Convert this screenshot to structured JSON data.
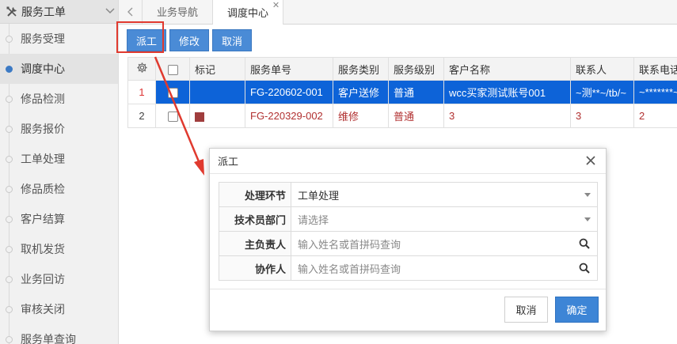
{
  "sidebar": {
    "title": "服务工单",
    "items": [
      {
        "label": "服务受理"
      },
      {
        "label": "调度中心",
        "active": true
      },
      {
        "label": "修品检测"
      },
      {
        "label": "服务报价"
      },
      {
        "label": "工单处理"
      },
      {
        "label": "修品质检"
      },
      {
        "label": "客户结算"
      },
      {
        "label": "取机发货"
      },
      {
        "label": "业务回访"
      },
      {
        "label": "审核关闭"
      },
      {
        "label": "服务单查询"
      }
    ]
  },
  "tabs": [
    {
      "label": "业务导航"
    },
    {
      "label": "调度中心",
      "active": true
    }
  ],
  "toolbar": {
    "dispatch": "派工",
    "edit": "修改",
    "cancel": "取消"
  },
  "table": {
    "headers": [
      "标记",
      "服务单号",
      "服务类别",
      "服务级别",
      "客户名称",
      "联系人",
      "联系电话"
    ],
    "rows": [
      {
        "num": "1",
        "mark": "",
        "order": "FG-220602-001",
        "category": "客户送修",
        "level": "普通",
        "customer": "wcc买家测试账号001",
        "contact": "~测**~/tb/~",
        "phone": "~*******~"
      },
      {
        "num": "2",
        "mark": "red",
        "order": "FG-220329-002",
        "category": "维修",
        "level": "普通",
        "customer": "3",
        "contact": "3",
        "phone": "2"
      }
    ]
  },
  "dialog": {
    "title": "派工",
    "fields": [
      {
        "label": "处理环节",
        "value": "工单处理",
        "type": "select"
      },
      {
        "label": "技术员部门",
        "placeholder": "请选择",
        "type": "select"
      },
      {
        "label": "主负责人",
        "placeholder": "输入姓名或首拼码查询",
        "type": "search"
      },
      {
        "label": "协作人",
        "placeholder": "输入姓名或首拼码查询",
        "type": "search"
      }
    ],
    "cancel": "取消",
    "ok": "确定"
  },
  "colors": {
    "accent": "#4a8bd6",
    "selected_row": "#0d63d8",
    "highlight": "#e03a2f",
    "mark": "#a03d3d"
  }
}
